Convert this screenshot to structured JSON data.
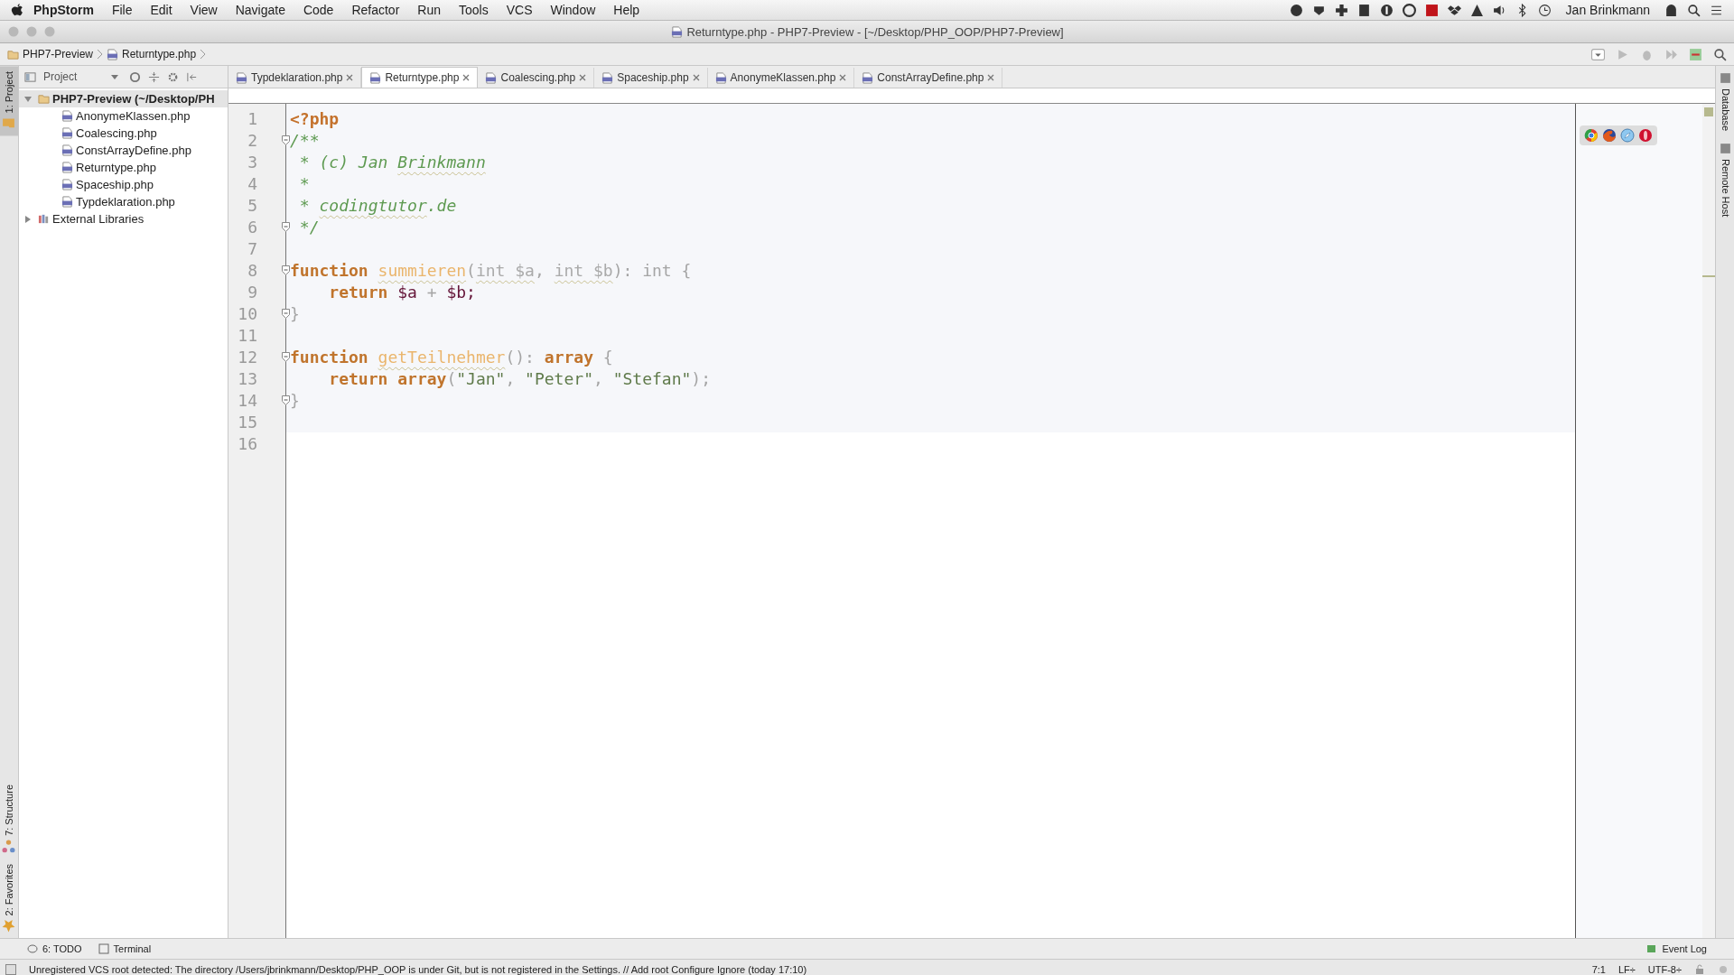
{
  "menu_bar": {
    "app": "PhpStorm",
    "items": [
      "File",
      "Edit",
      "View",
      "Navigate",
      "Code",
      "Refactor",
      "Run",
      "Tools",
      "VCS",
      "Window",
      "Help"
    ],
    "user": "Jan Brinkmann"
  },
  "window": {
    "title": "Returntype.php - PHP7-Preview - [~/Desktop/PHP_OOP/PHP7-Preview]"
  },
  "breadcrumb": [
    {
      "label": "PHP7-Preview",
      "kind": "folder"
    },
    {
      "label": "Returntype.php",
      "kind": "file"
    }
  ],
  "left_tool_strip": [
    {
      "label": "1: Project",
      "selected": true,
      "kind": "project"
    },
    {
      "label": "7: Structure",
      "selected": false,
      "kind": "structure"
    },
    {
      "label": "2: Favorites",
      "selected": false,
      "kind": "favorites"
    }
  ],
  "right_tool_strip": [
    {
      "label": "Database"
    },
    {
      "label": "Remote Host"
    }
  ],
  "project_panel": {
    "view": "Project",
    "tree": [
      {
        "label": "PHP7-Preview (~/Desktop/PH",
        "kind": "folder",
        "selected": true,
        "expanded": true,
        "children": [
          {
            "label": "AnonymeKlassen.php",
            "kind": "file",
            "selected": false
          },
          {
            "label": "Coalescing.php",
            "kind": "file",
            "selected": false
          },
          {
            "label": "ConstArrayDefine.php",
            "kind": "file",
            "selected": false
          },
          {
            "label": "Returntype.php",
            "kind": "file",
            "selected": false
          },
          {
            "label": "Spaceship.php",
            "kind": "file",
            "selected": false
          },
          {
            "label": "Typdeklaration.php",
            "kind": "file",
            "selected": false
          }
        ]
      },
      {
        "label": "External Libraries",
        "kind": "library",
        "selected": false,
        "expanded": false
      }
    ]
  },
  "tabs": [
    {
      "label": "Typdeklaration.php",
      "selected": false
    },
    {
      "label": "Returntype.php",
      "selected": true
    },
    {
      "label": "Coalescing.php",
      "selected": false
    },
    {
      "label": "Spaceship.php",
      "selected": false
    },
    {
      "label": "AnonymeKlassen.php",
      "selected": false
    },
    {
      "label": "ConstArrayDefine.php",
      "selected": false
    }
  ],
  "editor": {
    "lines": [
      {
        "number": "1",
        "fold": false,
        "tokens": [
          {
            "text": "<?php",
            "kind": "tag"
          }
        ]
      },
      {
        "number": "2",
        "fold": true,
        "tokens": [
          {
            "text": "/**",
            "kind": "comment"
          }
        ]
      },
      {
        "number": "3",
        "fold": false,
        "tokens": [
          {
            "text": " * (c) Jan ",
            "kind": "comment"
          },
          {
            "text": "Brinkmann",
            "kind": "comment",
            "squiggle": true
          }
        ]
      },
      {
        "number": "4",
        "fold": false,
        "tokens": [
          {
            "text": " *",
            "kind": "comment"
          }
        ]
      },
      {
        "number": "5",
        "fold": false,
        "tokens": [
          {
            "text": " * ",
            "kind": "comment"
          },
          {
            "text": "codingtutor",
            "kind": "comment",
            "squiggle": true
          },
          {
            "text": ".de",
            "kind": "comment"
          }
        ]
      },
      {
        "number": "6",
        "fold": true,
        "tokens": [
          {
            "text": " */",
            "kind": "comment"
          }
        ]
      },
      {
        "number": "7",
        "fold": false
      },
      {
        "number": "8",
        "fold": true,
        "tokens": [
          {
            "text": "function ",
            "kind": "keyword"
          },
          {
            "text": "summieren",
            "kind": "func",
            "squiggle": true
          },
          {
            "text": "(",
            "kind": "punct"
          },
          {
            "text": "int $a",
            "kind": "type",
            "squiggle": true
          },
          {
            "text": ", ",
            "kind": "punct"
          },
          {
            "text": "int $b",
            "kind": "type",
            "squiggle": true
          },
          {
            "text": "): int {",
            "kind": "punct"
          }
        ]
      },
      {
        "number": "9",
        "fold": false,
        "tokens": [
          {
            "text": "    return ",
            "kind": "keyword"
          },
          {
            "text": "$a",
            "kind": "var"
          },
          {
            "text": " + ",
            "kind": "punct"
          },
          {
            "text": "$b;",
            "kind": "var"
          }
        ]
      },
      {
        "number": "10",
        "fold": true,
        "tokens": [
          {
            "text": "}",
            "kind": "punct"
          }
        ]
      },
      {
        "number": "11",
        "fold": false
      },
      {
        "number": "12",
        "fold": true,
        "tokens": [
          {
            "text": "function ",
            "kind": "keyword"
          },
          {
            "text": "getTeilnehmer",
            "kind": "func",
            "squiggle": true
          },
          {
            "text": "(): ",
            "kind": "punct"
          },
          {
            "text": "array",
            "kind": "keyword"
          },
          {
            "text": " {",
            "kind": "punct"
          }
        ]
      },
      {
        "number": "13",
        "fold": false,
        "tokens": [
          {
            "text": "    return array",
            "kind": "keyword"
          },
          {
            "text": "(",
            "kind": "punct"
          },
          {
            "text": "\"Jan\"",
            "kind": "string"
          },
          {
            "text": ", ",
            "kind": "punct"
          },
          {
            "text": "\"Peter\"",
            "kind": "string"
          },
          {
            "text": ", ",
            "kind": "punct"
          },
          {
            "text": "\"Stefan\"",
            "kind": "string"
          },
          {
            "text": ");",
            "kind": "punct"
          }
        ]
      },
      {
        "number": "14",
        "fold": true,
        "tokens": [
          {
            "text": "}",
            "kind": "punct"
          }
        ]
      },
      {
        "number": "15",
        "fold": false
      },
      {
        "number": "16",
        "fold": false
      }
    ]
  },
  "bottom_tools": [
    {
      "label": "6: TODO",
      "kind": "todo"
    },
    {
      "label": "Terminal",
      "kind": "terminal"
    }
  ],
  "event_log": "Event Log",
  "status_bar": {
    "message": "Unregistered VCS root detected: The directory /Users/jbrinkmann/Desktop/PHP_OOP is under Git, but is not registered in the Settings. // Add root  Configure  Ignore (today 17:10)",
    "position": "7:1",
    "line_separator": "LF÷",
    "encoding": "UTF-8÷"
  }
}
